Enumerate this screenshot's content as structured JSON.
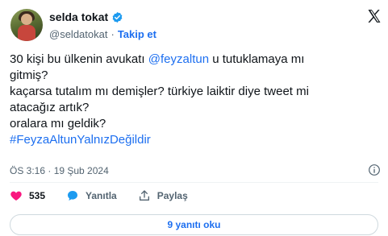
{
  "author": {
    "name": "selda tokat",
    "handle": "@seldatokat",
    "separator": "·",
    "follow_label": "Takip et"
  },
  "tweet": {
    "lines": [
      [
        {
          "t": "30 kişi bu ülkenin avukatı "
        },
        {
          "t": "@feyzaltun",
          "link": true
        },
        {
          "t": " u tutuklamaya mı"
        }
      ],
      [
        {
          "t": "gitmiş?"
        }
      ],
      [
        {
          "t": "kaçarsa tutalım mı demişler? türkiye laiktir diye tweet mi"
        }
      ],
      [
        {
          "t": "atacağız artık?"
        }
      ],
      [
        {
          "t": "oralara mı geldik?"
        }
      ],
      [
        {
          "t": "#FeyzaAltunYalnızDeğildir",
          "link": true
        }
      ]
    ]
  },
  "meta": {
    "timestamp": "ÖS 3:16 · 19 Şub 2024"
  },
  "actions": {
    "like_count": "535",
    "reply_label": "Yanıtla",
    "share_label": "Paylaş"
  },
  "read_replies_label": "9 yanıtı oku",
  "colors": {
    "link": "#1d6ff0",
    "like": "#f91880",
    "reply_icon": "#1d9bf0"
  },
  "icons": [
    "verified-badge-icon",
    "x-logo-icon",
    "info-icon",
    "heart-icon",
    "reply-bubble-icon",
    "share-icon"
  ]
}
